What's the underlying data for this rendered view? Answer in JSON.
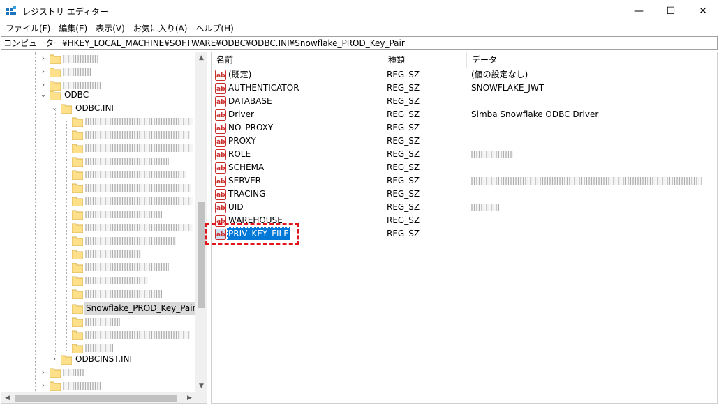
{
  "window": {
    "title": "レジストリ エディター",
    "minimize": "—",
    "maximize": "☐",
    "close": "✕"
  },
  "menu": [
    "ファイル(F)",
    "編集(E)",
    "表示(V)",
    "お気に入り(A)",
    "ヘルプ(H)"
  ],
  "address": "コンピューター¥HKEY_LOCAL_MACHINE¥SOFTWARE¥ODBC¥ODBC.INI¥Snowflake_PROD_Key_Pair",
  "tree": {
    "odbc": "ODBC",
    "odbc_ini": "ODBC.INI",
    "selected_key": "Snowflake_PROD_Key_Pair",
    "odbcinst": "ODBCINST.INI"
  },
  "columns": {
    "name": "名前",
    "type": "種類",
    "data": "データ"
  },
  "values": [
    {
      "name": "(既定)",
      "type": "REG_SZ",
      "data": "(値の設定なし)"
    },
    {
      "name": "AUTHENTICATOR",
      "type": "REG_SZ",
      "data": "SNOWFLAKE_JWT"
    },
    {
      "name": "DATABASE",
      "type": "REG_SZ",
      "data": ""
    },
    {
      "name": "Driver",
      "type": "REG_SZ",
      "data": "Simba Snowflake ODBC Driver"
    },
    {
      "name": "NO_PROXY",
      "type": "REG_SZ",
      "data": ""
    },
    {
      "name": "PROXY",
      "type": "REG_SZ",
      "data": ""
    },
    {
      "name": "ROLE",
      "type": "REG_SZ",
      "data": ""
    },
    {
      "name": "SCHEMA",
      "type": "REG_SZ",
      "data": ""
    },
    {
      "name": "SERVER",
      "type": "REG_SZ",
      "data": ""
    },
    {
      "name": "TRACING",
      "type": "REG_SZ",
      "data": ""
    },
    {
      "name": "UID",
      "type": "REG_SZ",
      "data": ""
    },
    {
      "name": "WAREHOUSE",
      "type": "REG_SZ",
      "data": ""
    },
    {
      "name": "PRIV_KEY_FILE",
      "type": "REG_SZ",
      "data": ""
    }
  ],
  "colors": {
    "selection": "#0078d7",
    "highlight": "#e0161d",
    "folder": "#ffe08a"
  }
}
